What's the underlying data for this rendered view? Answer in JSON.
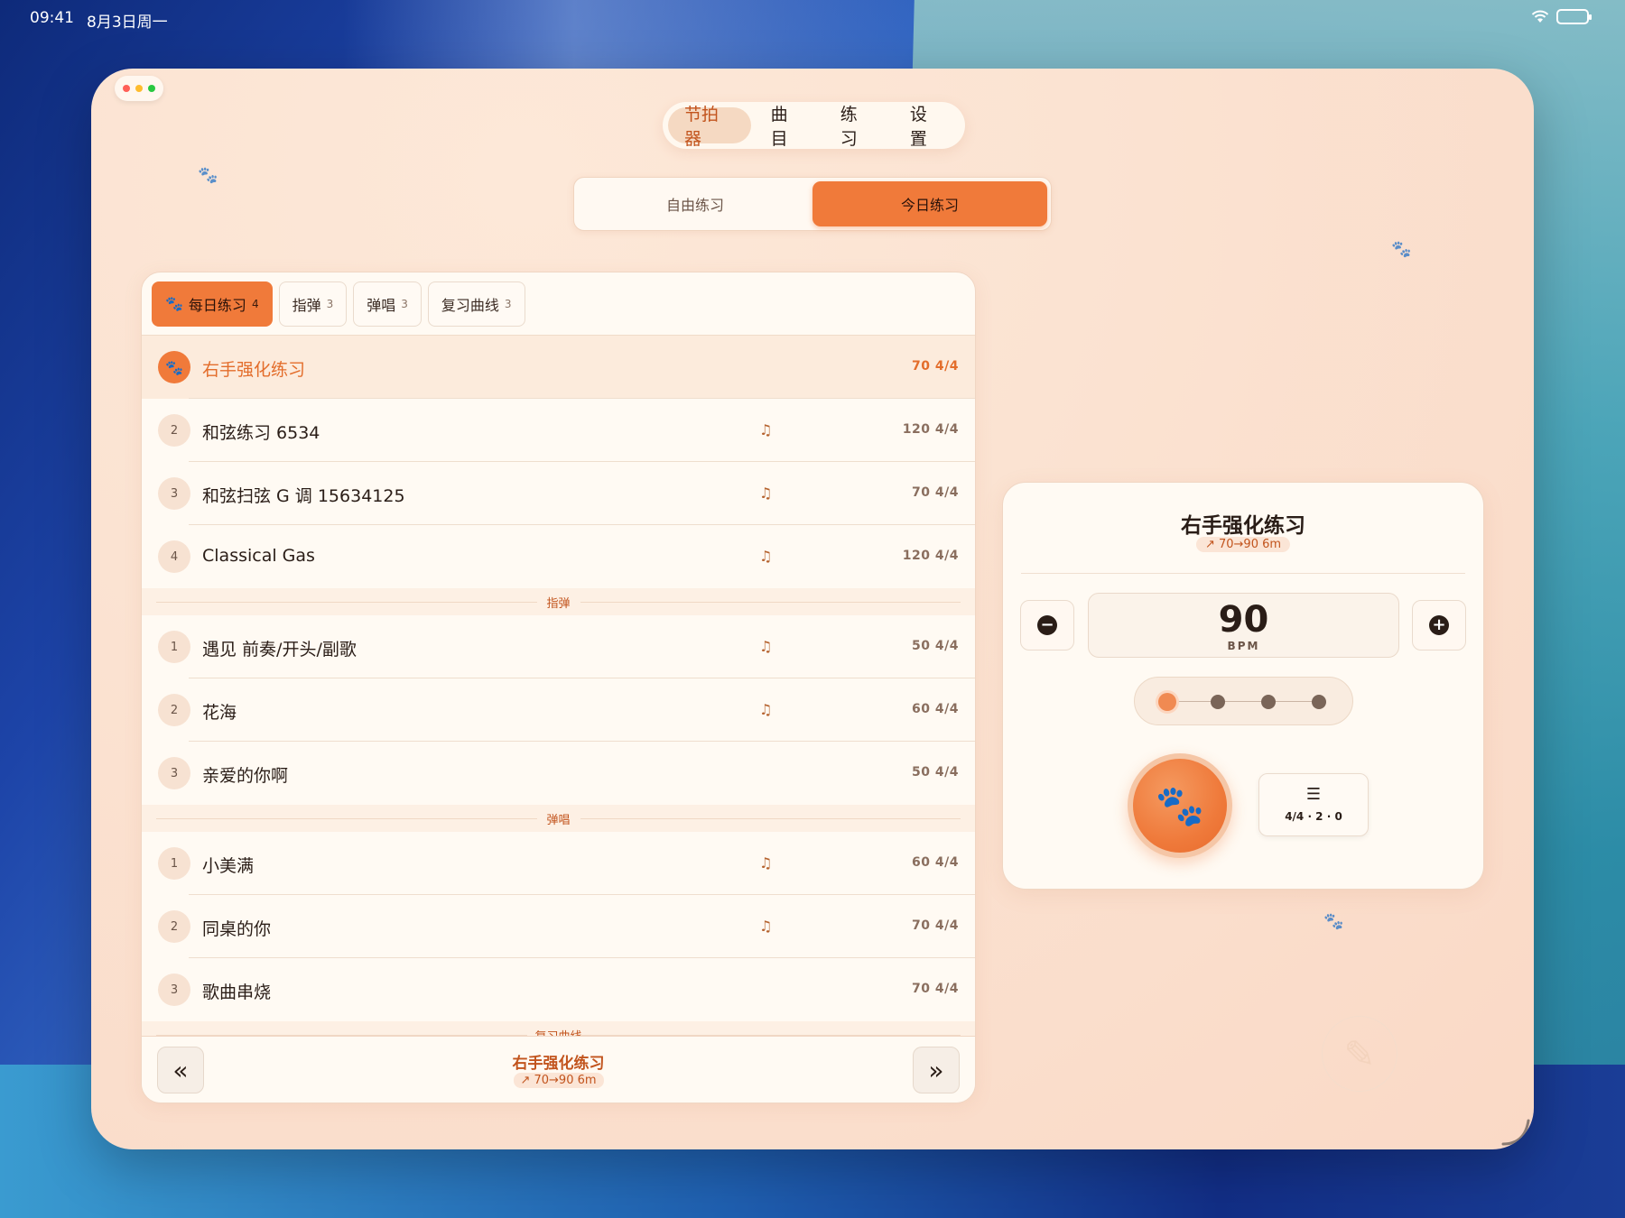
{
  "status": {
    "time": "09:41",
    "date": "8月3日周一"
  },
  "top_tabs": [
    {
      "label": "节拍器",
      "active": true
    },
    {
      "label": "曲目",
      "active": false
    },
    {
      "label": "练习",
      "active": false
    },
    {
      "label": "设置",
      "active": false
    }
  ],
  "mode": {
    "free_label": "自由练习",
    "today_label": "今日练习",
    "selected": "today"
  },
  "filters": [
    {
      "label": "每日练习",
      "count": "4",
      "active": true,
      "icon": "paw-icon"
    },
    {
      "label": "指弹",
      "count": "3",
      "active": false
    },
    {
      "label": "弹唱",
      "count": "3",
      "active": false
    },
    {
      "label": "复习曲线",
      "count": "3",
      "active": false
    }
  ],
  "list": {
    "daily": [
      {
        "num": "",
        "title": "右手强化练习",
        "meta": "70 4/4",
        "current": true,
        "has_note": false
      },
      {
        "num": "2",
        "title": "和弦练习 6534",
        "meta": "120 4/4",
        "has_note": true
      },
      {
        "num": "3",
        "title": "和弦扫弦 G 调 15634125",
        "meta": "70 4/4",
        "has_note": true
      },
      {
        "num": "4",
        "title": "Classical Gas",
        "meta": "120 4/4",
        "has_note": true
      }
    ],
    "section_fingerstyle": "指弹",
    "fingerstyle": [
      {
        "num": "1",
        "title": "遇见 前奏/开头/副歌",
        "meta": "50 4/4",
        "has_note": true
      },
      {
        "num": "2",
        "title": "花海",
        "meta": "60 4/4",
        "has_note": true
      },
      {
        "num": "3",
        "title": "亲爱的你啊",
        "meta": "50 4/4",
        "has_note": false
      }
    ],
    "section_singing": "弹唱",
    "singing": [
      {
        "num": "1",
        "title": "小美满",
        "meta": "60 4/4",
        "has_note": true
      },
      {
        "num": "2",
        "title": "同桌的你",
        "meta": "70 4/4",
        "has_note": true
      },
      {
        "num": "3",
        "title": "歌曲串烧",
        "meta": "70 4/4",
        "has_note": false
      }
    ],
    "section_review": "复习曲线"
  },
  "footer": {
    "title": "右手强化练习",
    "badge": "↗ 70→90 6m",
    "prev": "«",
    "next": "»"
  },
  "metronome": {
    "title": "右手强化练习",
    "badge": "↗ 70→90 6m",
    "bpm": "90",
    "bpm_label": "BPM",
    "beats": 4,
    "active_beat": 1,
    "settings_summary": "4/4 · 2 · 0",
    "minus": "−",
    "plus": "+"
  },
  "colors": {
    "accent": "#f07a3a",
    "accent_text": "#c2541d",
    "window_bg": "#fbe3d2"
  }
}
